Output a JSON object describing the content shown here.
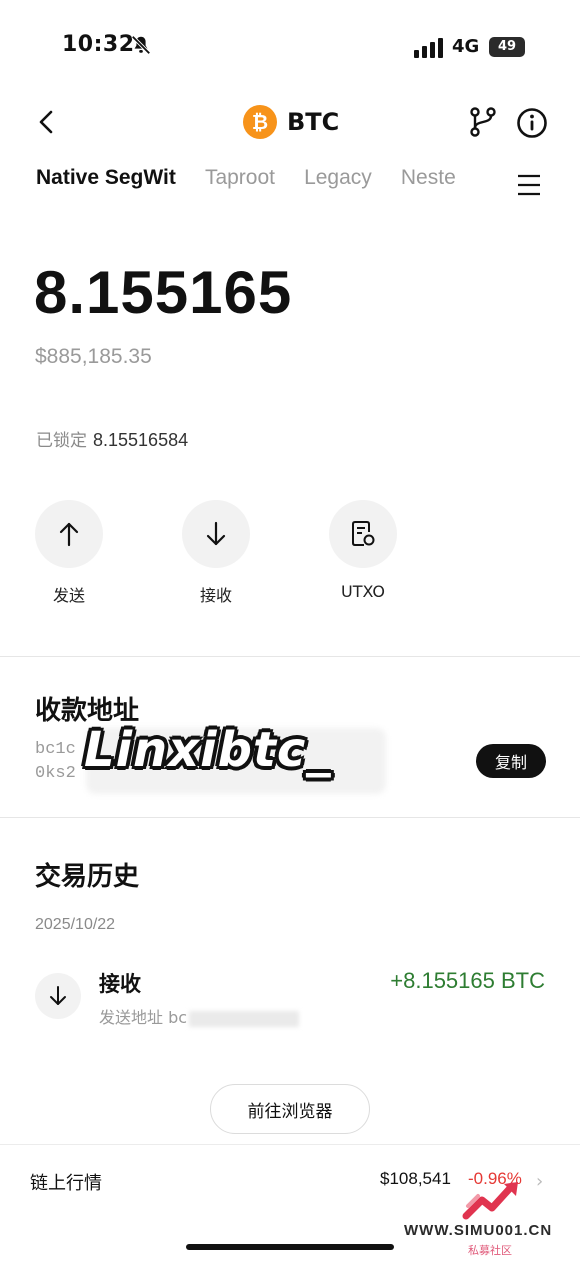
{
  "status_bar": {
    "time": "10:32",
    "network": "4G",
    "battery": "49"
  },
  "nav": {
    "coin_logo": "₿",
    "title": "BTC"
  },
  "address_tabs": [
    "Native SegWit",
    "Taproot",
    "Legacy",
    "Neste"
  ],
  "balance": {
    "amount": "8.155165",
    "fiat": "$885,185.35",
    "locked_label": "已锁定",
    "locked_value": "8.15516584"
  },
  "actions": [
    {
      "label": "发送",
      "icon": "arrow-up-icon"
    },
    {
      "label": "接收",
      "icon": "arrow-down-icon"
    },
    {
      "label": "UTXO",
      "icon": "utxo-icon"
    }
  ],
  "receive_address": {
    "title": "收款地址",
    "line1": "bc1c",
    "line2": "0ks2",
    "copy_label": "复制",
    "watermark": "Linxibtc_"
  },
  "history": {
    "title": "交易历史",
    "date": "2025/10/22",
    "tx_type": "接收",
    "tx_from_label": "发送地址",
    "tx_from_addr": "bc",
    "tx_amount": "+8.155165 BTC",
    "explorer_label": "前往浏览器"
  },
  "market": {
    "label": "链上行情",
    "price": "$108,541",
    "change": "-0.96%",
    "chevron": "›"
  },
  "site_watermark": {
    "url": "WWW.SIMU001.CN",
    "sub": "私募社区"
  },
  "colors": {
    "btc_orange": "#f7931a",
    "positive_green": "#2e7d32",
    "negative_red": "#e53935"
  }
}
